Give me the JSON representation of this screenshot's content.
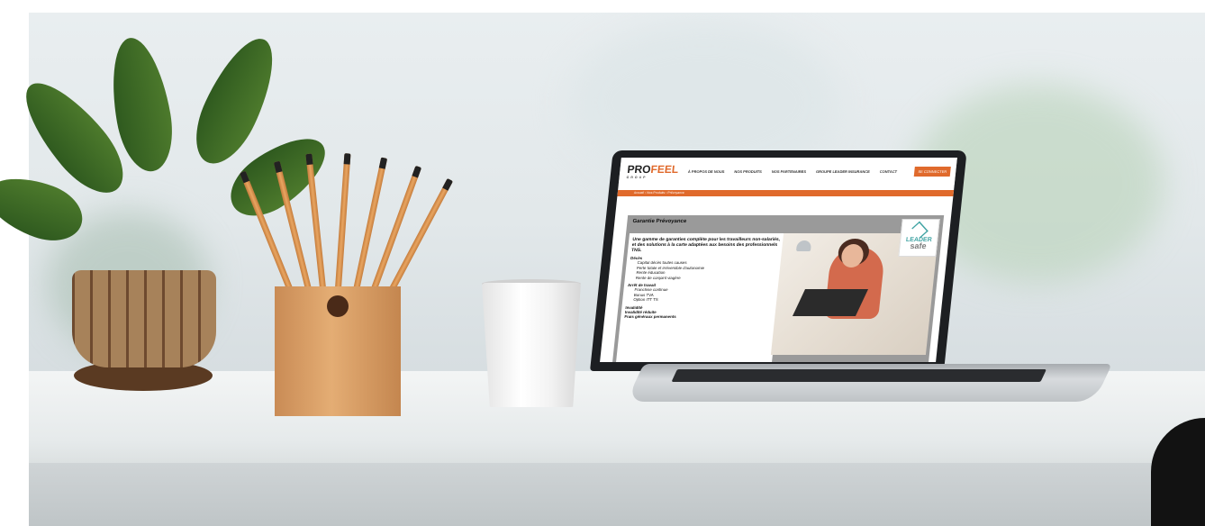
{
  "laptop_screen": {
    "logo": {
      "pro": "PRO",
      "feel": "FEEL",
      "sub": "GROUP"
    },
    "nav_items": [
      "À PROPOS DE NOUS",
      "NOS PRODUITS",
      "NOS PARTENAIRES",
      "GROUPE LEADER INSURANCE",
      "CONTACT"
    ],
    "nav_button": "SE CONNECTER",
    "breadcrumb": "Accueil › Nos Produits › Prévoyance",
    "section_title": "Garantie Prévoyance",
    "intro": "Une gamme de garanties complète pour les travailleurs non-salariés, et des solutions à la carte adaptées aux besoins des professionnels TNS.",
    "blocks": [
      {
        "heading": "Décès",
        "items": [
          "Capital décès toutes causes",
          "Perte totale et irréversible d'autonomie",
          "Rente éducation",
          "Rente de conjoint viagère"
        ]
      },
      {
        "heading": "Arrêt de travail",
        "items": [
          "Franchise continue",
          "Bonus TVA",
          "Option ITT TS"
        ]
      },
      {
        "heading": "Invalidité",
        "items": []
      },
      {
        "heading": "Invalidité réduite",
        "items": []
      },
      {
        "heading": "Frais généraux permanents",
        "items": []
      }
    ],
    "leader_logo": {
      "line1": "LEADER",
      "line2": "safe"
    }
  }
}
